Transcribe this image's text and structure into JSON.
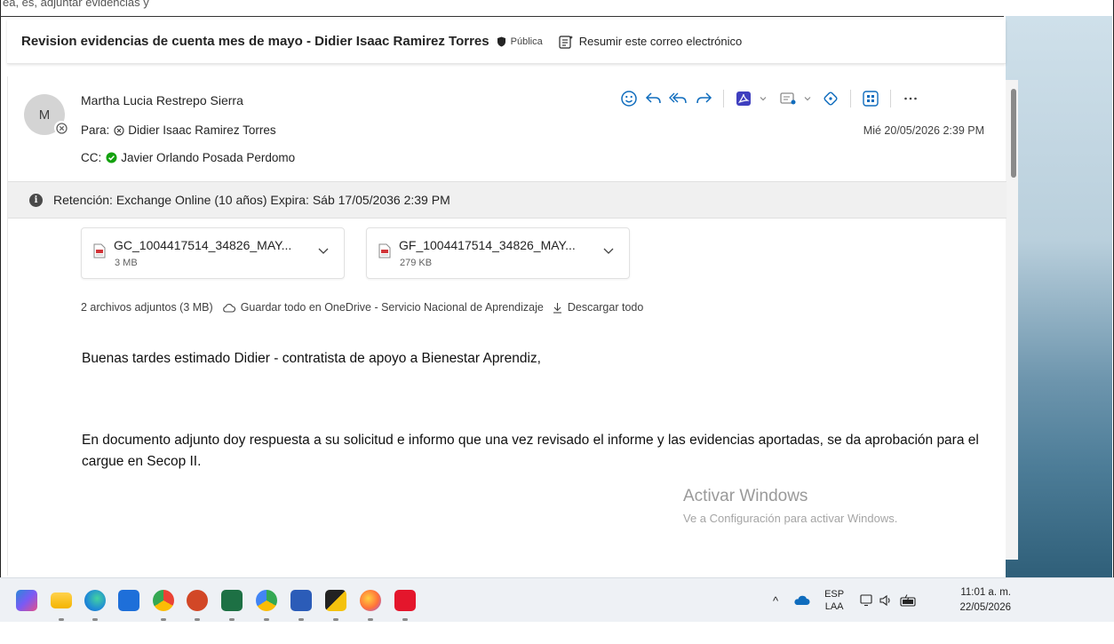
{
  "top_crumb": "ea, es, adjuntar evidencias y",
  "subject": {
    "title": "Revision evidencias de cuenta mes de mayo - Didier Isaac Ramirez Torres",
    "sensitivity": "Pública",
    "summarize": "Resumir este correo electrónico"
  },
  "message": {
    "avatar_initial": "M",
    "sender": "Martha Lucia Restrepo Sierra",
    "to_label": "Para:",
    "to": "Didier Isaac Ramirez Torres",
    "cc_label": "CC:",
    "cc": "Javier Orlando Posada Perdomo",
    "date": "Mié 20/05/2026 2:39 PM",
    "retention": "Retención: Exchange Online (10 años) Expira: Sáb 17/05/2036 2:39 PM"
  },
  "attachments": [
    {
      "name": "GC_1004417514_34826_MAY...",
      "size": "3 MB"
    },
    {
      "name": "GF_1004417514_34826_MAY...",
      "size": "279 KB"
    }
  ],
  "attachment_actions": {
    "summary": "2 archivos adjuntos (3 MB)",
    "save_all": "Guardar todo en OneDrive - Servicio Nacional de Aprendizaje",
    "download_all": "Descargar todo"
  },
  "body": {
    "greeting": "Buenas tardes estimado Didier - contratista de apoyo a Bienestar Aprendiz,",
    "paragraph": "En documento adjunto doy respuesta a su solicitud e informo que una vez revisado el informe y las evidencias aportadas, se da aprobación para el cargue en Secop II."
  },
  "watermark": {
    "title": "Activar Windows",
    "subtitle": "Ve a Configuración para activar Windows."
  },
  "taskbar": {
    "lang_top": "ESP",
    "lang_bottom": "LAA",
    "time": "11:01 a. m.",
    "date": "22/05/2026"
  }
}
